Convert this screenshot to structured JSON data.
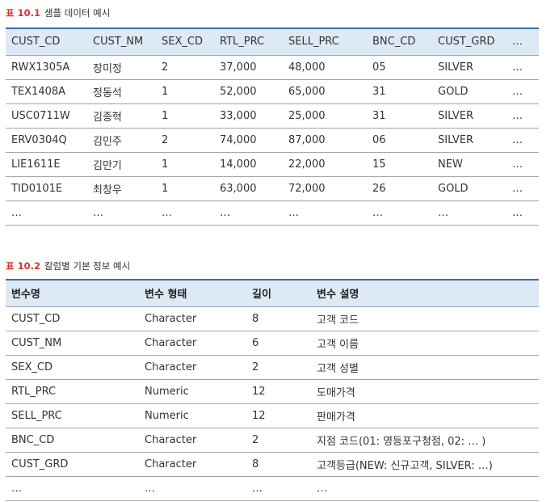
{
  "table1": {
    "caption_num": "표 10.1",
    "caption_text": "샘플 데이터 예시",
    "headers": [
      "CUST_CD",
      "CUST_NM",
      "SEX_CD",
      "RTL_PRC",
      "SELL_PRC",
      "BNC_CD",
      "CUST_GRD",
      "…"
    ],
    "rows": [
      [
        "RWX1305A",
        "장미정",
        "2",
        "37,000",
        "48,000",
        "05",
        "SILVER",
        "…"
      ],
      [
        "TEX1408A",
        "정동석",
        "1",
        "52,000",
        "65,000",
        "31",
        "GOLD",
        "…"
      ],
      [
        "USC0711W",
        "김종혁",
        "1",
        "33,000",
        "25,000",
        "31",
        "SILVER",
        "…"
      ],
      [
        "ERV0304Q",
        "김민주",
        "2",
        "74,000",
        "87,000",
        "06",
        "SILVER",
        "…"
      ],
      [
        "LIE1611E",
        "김만기",
        "1",
        "14,000",
        "22,000",
        "15",
        "NEW",
        "…"
      ],
      [
        "TID0101E",
        "최창우",
        "1",
        "63,000",
        "72,000",
        "26",
        "GOLD",
        "…"
      ],
      [
        "…",
        "…",
        "…",
        "…",
        "…",
        "…",
        "…",
        "…"
      ]
    ]
  },
  "table2": {
    "caption_num": "표 10.2",
    "caption_text": "칼럼별 기본 정보 예시",
    "headers": [
      "변수명",
      "변수 형태",
      "길이",
      "변수 설명"
    ],
    "rows": [
      [
        "CUST_CD",
        "Character",
        "8",
        "고객 코드"
      ],
      [
        "CUST_NM",
        "Character",
        "6",
        "고객 이름"
      ],
      [
        "SEX_CD",
        "Character",
        "2",
        "고객 성별"
      ],
      [
        "RTL_PRC",
        "Numeric",
        "12",
        "도매가격"
      ],
      [
        "SELL_PRC",
        "Numeric",
        "12",
        "판매가격"
      ],
      [
        "BNC_CD",
        "Character",
        "2",
        "지점 코드(01: 영등포구청점, 02: … )"
      ],
      [
        "CUST_GRD",
        "Character",
        "8",
        "고객등급(NEW: 신규고객, SILVER: …)"
      ],
      [
        "…",
        "…",
        "…",
        "…"
      ]
    ]
  }
}
